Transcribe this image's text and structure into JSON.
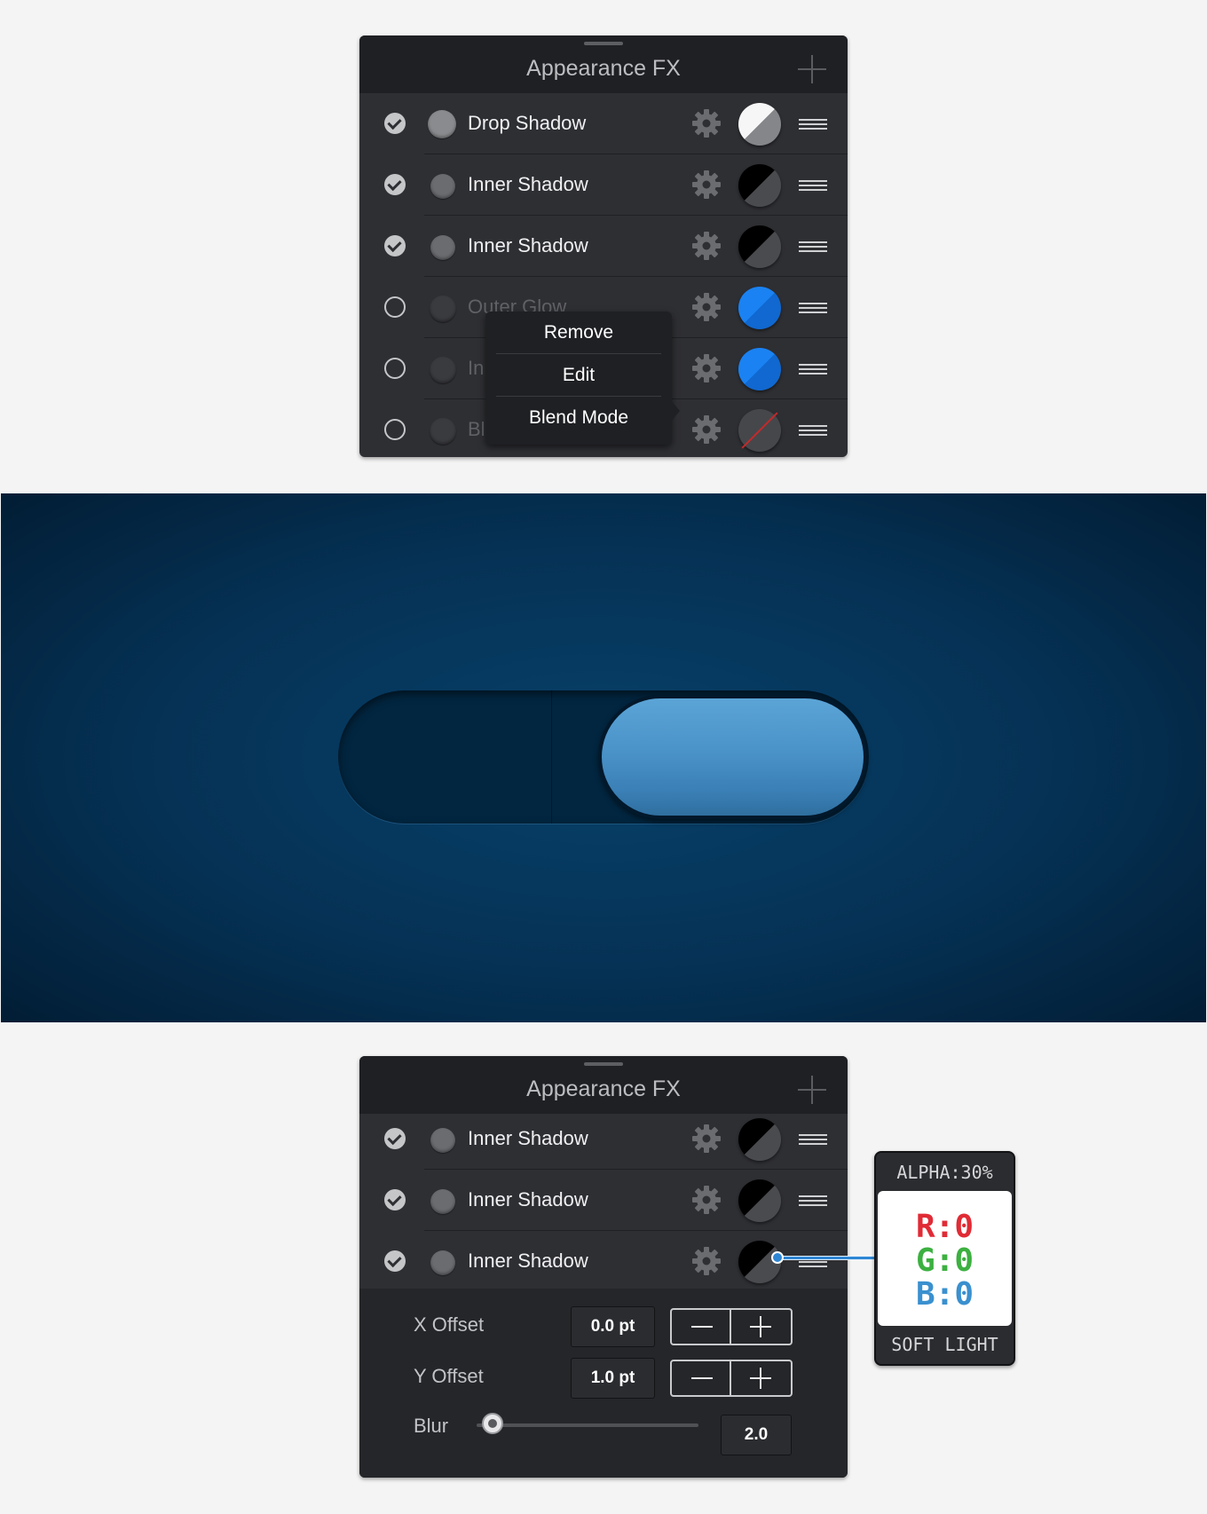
{
  "top_panel": {
    "title": "Appearance FX",
    "rows": [
      {
        "name": "Drop Shadow",
        "enabled": true,
        "swatch": "white"
      },
      {
        "name": "Inner Shadow",
        "enabled": true,
        "swatch": "black"
      },
      {
        "name": "Inner Shadow",
        "enabled": true,
        "swatch": "black"
      },
      {
        "name": "Outer Glow",
        "enabled": false,
        "swatch": "blue"
      },
      {
        "name": "In",
        "enabled": false,
        "swatch": "blue"
      },
      {
        "name": "Bl",
        "enabled": false,
        "swatch": "none"
      }
    ],
    "context_menu": [
      "Remove",
      "Edit",
      "Blend Mode"
    ]
  },
  "bottom_panel": {
    "title": "Appearance FX",
    "rows": [
      {
        "name": "Inner Shadow",
        "enabled": true,
        "swatch": "black"
      },
      {
        "name": "Inner Shadow",
        "enabled": true,
        "swatch": "black"
      },
      {
        "name": "Inner Shadow",
        "enabled": true,
        "swatch": "black"
      }
    ],
    "properties": {
      "x_offset_label": "X Offset",
      "x_offset_value": "0.0 pt",
      "y_offset_label": "Y Offset",
      "y_offset_value": "1.0 pt",
      "blur_label": "Blur",
      "blur_value": "2.0",
      "blur_slider_fraction": 0.07
    }
  },
  "callout": {
    "alpha": "ALPHA:30%",
    "r": "R:0",
    "g": "G:0",
    "b": "B:0",
    "blend_mode": "SOFT LIGHT",
    "line_color": "#2e86d4"
  },
  "scene": {
    "background_color": "#053154",
    "knob_color": "#4a93c9",
    "toggle_state": "on"
  },
  "icons": {
    "check": "check-circle-icon",
    "gear": "gear-icon",
    "handle": "drag-handle-icon",
    "add": "plus-icon"
  }
}
